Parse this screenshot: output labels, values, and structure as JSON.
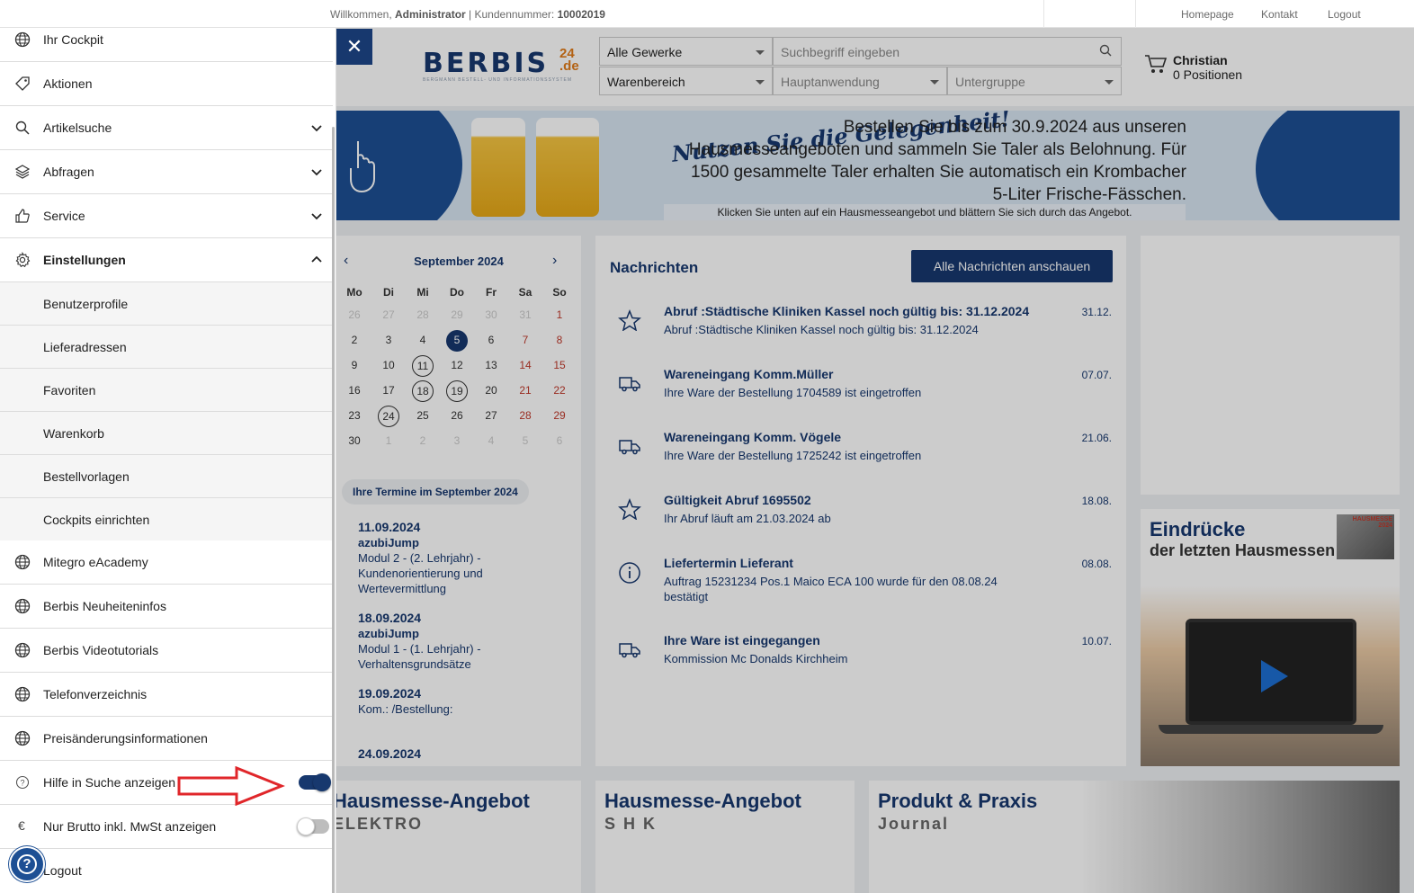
{
  "topbar": {
    "welcome_prefix": "Willkommen,",
    "user": "Administrator",
    "customer_label": "| Kundennummer:",
    "customer_number": "10002019",
    "links": [
      "Homepage",
      "Kontakt",
      "Logout"
    ]
  },
  "header": {
    "logo_text": "BERBIS",
    "logo_sup_num": "24",
    "logo_sup_tld": ".de",
    "logo_sub": "BERGMANN BESTELL- UND INFORMATIONSSYSTEM",
    "trade_select": "Alle Gewerke",
    "search_placeholder": "Suchbegriff eingeben",
    "warenbereich": "Warenbereich",
    "hauptanwendung": "Hauptanwendung",
    "untergruppe": "Untergruppe",
    "cart_name": "Christian",
    "cart_positions": "0 Positionen",
    "close_glyph": "✕"
  },
  "banner": {
    "slogan": "Nutzen Sie die Gelegenheit!",
    "text": "Bestellen Sie bis zum 30.9.2024 aus unseren Hausmesseangeboten und sammeln Sie Taler als Belohnung. Für 1500 gesammelte Taler erhalten Sie automatisch ein Krombacher 5-Liter Frische-Fässchen.",
    "small": "Klicken Sie unten auf ein Hausmesseangebot und blättern Sie sich durch das Angebot."
  },
  "calendar": {
    "month": "September 2024",
    "prev": "‹",
    "next": "›",
    "weekdays": [
      "Mo",
      "Di",
      "Mi",
      "Do",
      "Fr",
      "Sa",
      "So"
    ],
    "weeks": [
      [
        "26",
        "27",
        "28",
        "29",
        "30",
        "31",
        "1"
      ],
      [
        "2",
        "3",
        "4",
        "5",
        "6",
        "7",
        "8"
      ],
      [
        "9",
        "10",
        "11",
        "12",
        "13",
        "14",
        "15"
      ],
      [
        "16",
        "17",
        "18",
        "19",
        "20",
        "21",
        "22"
      ],
      [
        "23",
        "24",
        "25",
        "26",
        "27",
        "28",
        "29"
      ],
      [
        "30",
        "1",
        "2",
        "3",
        "4",
        "5",
        "6"
      ]
    ],
    "termine_head": "Ihre Termine im September 2024",
    "events": [
      {
        "date": "11.09.2024",
        "title": "azubiJump",
        "text": "Modul 2 - (2. Lehrjahr) - Kundenorientierung und Wertevermittlung"
      },
      {
        "date": "18.09.2024",
        "title": "azubiJump",
        "text": "Modul 1 - (1. Lehrjahr) - Verhaltensgrundsätze"
      },
      {
        "date": "19.09.2024",
        "title": "",
        "text": "Kom.: /Bestellung:"
      },
      {
        "date": "24.09.2024",
        "title": "",
        "text": ""
      }
    ]
  },
  "news": {
    "heading": "Nachrichten",
    "all_button": "Alle Nachrichten anschauen",
    "items": [
      {
        "icon": "star-icon",
        "title": "Abruf :Städtische Kliniken Kassel noch gültig bis: 31.12.2024",
        "text": "Abruf :Städtische Kliniken Kassel noch gültig bis: 31.12.2024",
        "date": "31.12."
      },
      {
        "icon": "truck-icon",
        "title": "Wareneingang Komm.Müller",
        "text": "Ihre Ware der Bestellung 1704589 ist eingetroffen",
        "date": "07.07."
      },
      {
        "icon": "truck-icon",
        "title": "Wareneingang Komm. Vögele",
        "text": "Ihre Ware der Bestellung 1725242 ist eingetroffen",
        "date": "21.06."
      },
      {
        "icon": "star-icon",
        "title": "Gültigkeit Abruf 1695502",
        "text": "Ihr Abruf läuft am 21.03.2024 ab",
        "date": "18.08."
      },
      {
        "icon": "info-icon",
        "title": "Liefertermin Lieferant",
        "text": "Auftrag 15231234 Pos.1 Maico ECA 100 wurde für den 08.08.24 bestätigt",
        "date": "08.08."
      },
      {
        "icon": "truck-icon",
        "title": "Ihre Ware ist eingegangen",
        "text": "Kommission Mc Donalds Kirchheim",
        "date": "10.07."
      }
    ]
  },
  "side": {
    "heading": "Eindrücke",
    "sub": "der letzten Hausmessen",
    "badge": "HAUSMESSE 2024"
  },
  "promos": [
    {
      "title": "Hausmesse-Angebot",
      "sub": "ELEKTRO"
    },
    {
      "title": "Hausmesse-Angebot",
      "sub": "S H K"
    },
    {
      "title": "Produkt & Praxis",
      "sub": "Journal"
    }
  ],
  "menu": {
    "items": [
      {
        "label": "Ihr Cockpit",
        "icon": "globe-icon"
      },
      {
        "label": "Aktionen",
        "icon": "tag-icon"
      },
      {
        "label": "Artikelsuche",
        "icon": "search-icon"
      },
      {
        "label": "Abfragen",
        "icon": "layers-icon"
      },
      {
        "label": "Service",
        "icon": "thumb-icon"
      },
      {
        "label": "Einstellungen",
        "icon": "gear-icon"
      }
    ],
    "sub_items": [
      "Benutzerprofile",
      "Lieferadressen",
      "Favoriten",
      "Warenkorb",
      "Bestellvorlagen",
      "Cockpits einrichten"
    ],
    "links": [
      "Mitegro eAcademy",
      "Berbis Neuheiteninfos",
      "Berbis Videotutorials",
      "Telefonverzeichnis",
      "Preisänderungsinformationen"
    ],
    "toggle_help": "Hilfe in Suche anzeigen",
    "toggle_help_on": true,
    "toggle_brutto": "Nur Brutto inkl. MwSt anzeigen",
    "toggle_brutto_on": false,
    "euro_glyph": "€",
    "logout": "Logout",
    "help_glyph": "?"
  },
  "colors": {
    "brand": "#17386e",
    "weekend": "#c0392b",
    "annotation_arrow": "#e0262a"
  }
}
